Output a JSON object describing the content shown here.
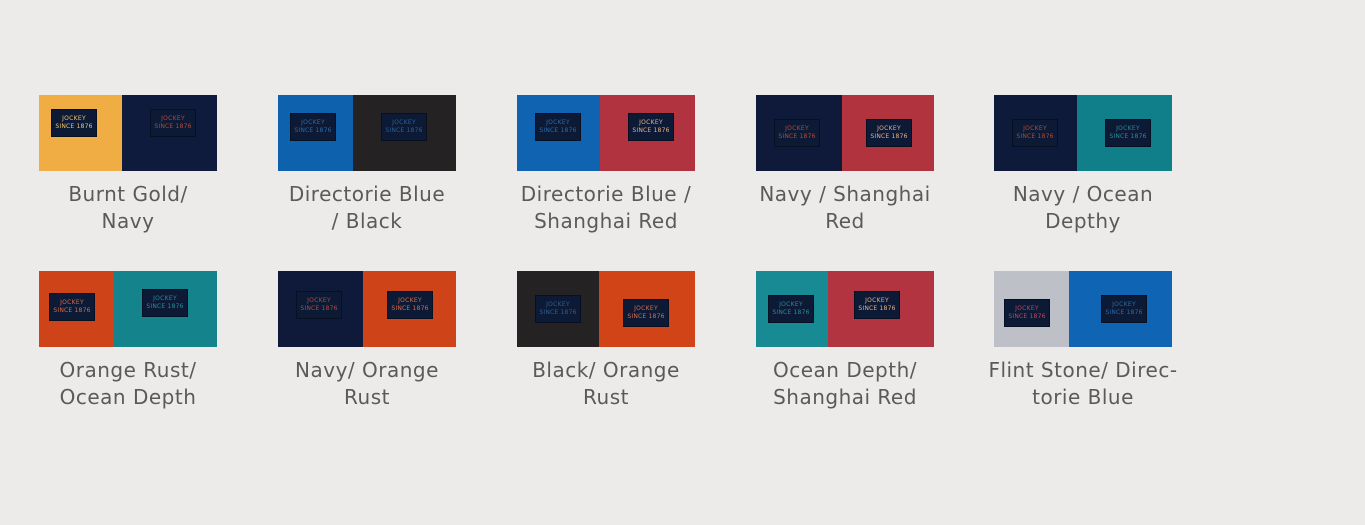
{
  "logo_text": "JOCKEY",
  "logo_since": "SINCE 1876",
  "swatches": [
    {
      "label": "Burnt Gold/\nNavy",
      "left": "#f0ad43",
      "right": "#0e1b3c",
      "tag_ink_left": "#f2c56a",
      "tag_ink_right": "#b24a3a"
    },
    {
      "label": "Directorie Blue\n/ Black",
      "left": "#0e62ad",
      "right": "#242223",
      "tag_ink_left": "#2c6aa8",
      "tag_ink_right": "#2e5f92"
    },
    {
      "label": "Directorie Blue /\nShanghai Red",
      "left": "#0f63b0",
      "right": "#b1333f",
      "tag_ink_left": "#2c6aa8",
      "tag_ink_right": "#e5b08a"
    },
    {
      "label": "Navy / Shanghai\nRed",
      "left": "#0f1a3a",
      "right": "#b0333e",
      "tag_ink_left": "#b24a3a",
      "tag_ink_right": "#e5b08a"
    },
    {
      "label": "Navy / Ocean\nDepthy",
      "left": "#0e1a3a",
      "right": "#117f8a",
      "tag_ink_left": "#b24a3a",
      "tag_ink_right": "#2b8c97"
    },
    {
      "label": "Orange Rust/\nOcean Depth",
      "left": "#cf4318",
      "right": "#15838b",
      "tag_ink_left": "#d96b47",
      "tag_ink_right": "#2b8c97"
    },
    {
      "label": "Navy/ Orange\nRust",
      "left": "#0f1a3b",
      "right": "#cf4318",
      "tag_ink_left": "#b24a3a",
      "tag_ink_right": "#d96b47"
    },
    {
      "label": "Black/ Orange\nRust",
      "left": "#252223",
      "right": "#d14417",
      "tag_ink_left": "#2e5f92",
      "tag_ink_right": "#d96b47"
    },
    {
      "label": "Ocean Depth/\nShanghai Red",
      "left": "#178a93",
      "right": "#b13440",
      "tag_ink_left": "#2b8c97",
      "tag_ink_right": "#e5b08a"
    },
    {
      "label": "Flint Stone/ Direc-\ntorie Blue",
      "left": "#bdc0c6",
      "right": "#0f65b3",
      "tag_ink_left": "#c0455a",
      "tag_ink_right": "#2c6aa8"
    }
  ]
}
